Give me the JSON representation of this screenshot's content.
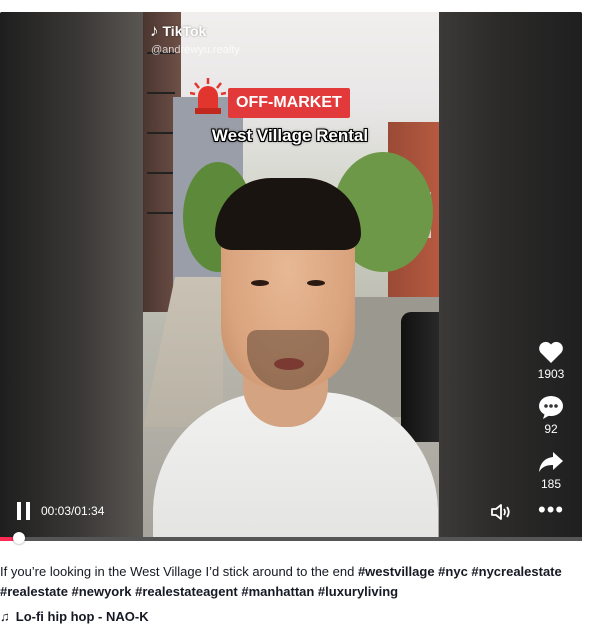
{
  "player": {
    "brand": "TikTok",
    "username": "@andrewyu.realty",
    "badge": "OFF-MARKET",
    "overlay_caption": "West Village Rental",
    "time": "00:03/01:34",
    "progress": 0.032,
    "actions": [
      {
        "icon": "heart-icon",
        "count": "1903"
      },
      {
        "icon": "comment-icon",
        "count": "92"
      },
      {
        "icon": "share-icon",
        "count": "185"
      }
    ]
  },
  "description": {
    "text": "If you’re looking in the West Village I’d stick around to the end ",
    "hashtags": "#westvillage #nyc #nycrealestate #realestate #newyork #realestateagent #manhattan #luxuryliving"
  },
  "music": {
    "title": "Lo-fi hip hop - NAO-K"
  }
}
